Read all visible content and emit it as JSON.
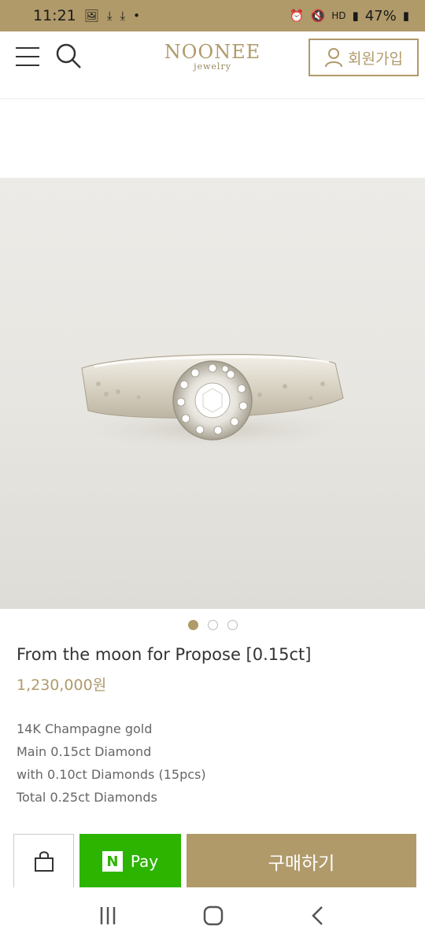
{
  "status": {
    "time": "11:21",
    "battery": "47%",
    "network": "HD"
  },
  "header": {
    "brand": "NOONEE",
    "brand_sub": "jewelry",
    "join_label": "회원가입"
  },
  "carousel": {
    "total": 3,
    "active": 0
  },
  "product": {
    "title": "From the moon for Propose [0.15ct]",
    "price": "1,230,000원",
    "description": [
      "14K Champagne gold",
      "Main 0.15ct Diamond",
      "with 0.10ct Diamonds (15pcs)",
      "Total 0.25ct Diamonds"
    ]
  },
  "actions": {
    "npay_label": "Pay",
    "npay_n": "N",
    "buy_label": "구매하기"
  },
  "colors": {
    "accent": "#b09a6a",
    "npay": "#2db400"
  }
}
